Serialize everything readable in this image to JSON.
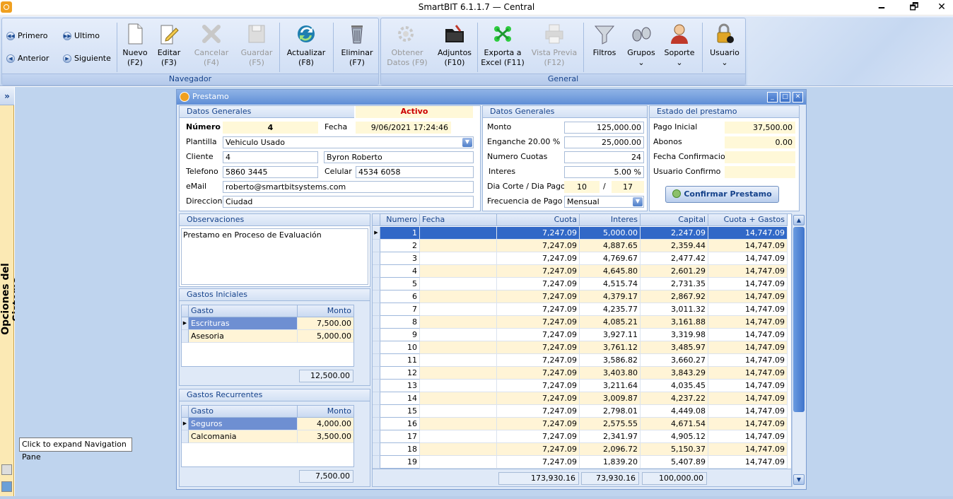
{
  "window": {
    "title": "SmartBIT 6.1.1.7 — Central",
    "minimize": "🗕",
    "maximize": "🗗",
    "close": "✕"
  },
  "ribbon": {
    "navegador": {
      "label": "Navegador",
      "primero": "Primero",
      "ultimo": "Ultimo",
      "anterior": "Anterior",
      "siguiente": "Siguiente",
      "nuevo": [
        "Nuevo",
        "(F2)"
      ],
      "editar": [
        "Editar",
        "(F3)"
      ],
      "cancelar": [
        "Cancelar",
        "(F4)"
      ],
      "guardar": [
        "Guardar",
        "(F5)"
      ],
      "actualizar": [
        "Actualizar",
        "(F8)"
      ],
      "eliminar": [
        "Eliminar",
        "(F7)"
      ]
    },
    "general": {
      "label": "General",
      "obtener": [
        "Obtener",
        "Datos (F9)"
      ],
      "adjuntos": [
        "Adjuntos",
        "(F10)"
      ],
      "exporta": [
        "Exporta a",
        "Excel (F11)"
      ],
      "vista": [
        "Vista Previa",
        "(F12)"
      ],
      "filtros": "Filtros",
      "grupos": "Grupos",
      "soporte": "Soporte",
      "usuario": "Usuario",
      "caret": "⌄"
    }
  },
  "navpane": {
    "toggle": "»",
    "title": "Opciones del Sistema"
  },
  "tooltip": "Click to expand Navigation Pane",
  "form": {
    "title": "Prestamo",
    "datos_generales": {
      "header": "Datos Generales",
      "estado": "Activo",
      "numero_label": "Número",
      "numero": "4",
      "fecha_label": "Fecha",
      "fecha": "9/06/2021 17:24:46",
      "plantilla_label": "Plantilla",
      "plantilla": "Vehiculo Usado",
      "cliente_label": "Cliente",
      "cliente_id": "4",
      "cliente_nombre": "Byron Roberto",
      "telefono_label": "Telefono",
      "telefono": "5860 3445",
      "celular_label": "Celular",
      "celular": "4534 6058",
      "email_label": "eMail",
      "email": "roberto@smartbitsystems.com",
      "direccion_label": "Direccion",
      "direccion": "Ciudad"
    },
    "datos_generales2": {
      "header": "Datos Generales",
      "monto_label": "Monto",
      "monto": "125,000.00",
      "enganche_label": "Enganche 20.00 %",
      "enganche": "25,000.00",
      "cuotas_label": "Numero Cuotas",
      "cuotas": "24",
      "interes_label": "Interes",
      "interes": "5.00 %",
      "dia_label": "Dia Corte / Dia Pago",
      "dia_corte": "10",
      "dia_sep": "/",
      "dia_pago": "17",
      "frecuencia_label": "Frecuencia de Pago",
      "frecuencia": "Mensual"
    },
    "estado_prestamo": {
      "header": "Estado del prestamo",
      "pago_inicial_label": "Pago Inicial",
      "pago_inicial": "37,500.00",
      "abonos_label": "Abonos",
      "abonos": "0.00",
      "fecha_conf_label": "Fecha Confirmacion",
      "fecha_conf": "",
      "usuario_conf_label": "Usuario Confirmo",
      "usuario_conf": "",
      "confirm_button": "Confirmar Prestamo"
    },
    "observaciones": {
      "header": "Observaciones",
      "text": "Prestamo en Proceso de Evaluación"
    },
    "gastos_iniciales": {
      "header": "Gastos Iniciales",
      "col_gasto": "Gasto",
      "col_monto": "Monto",
      "rows": [
        {
          "gasto": "Escrituras",
          "monto": "7,500.00"
        },
        {
          "gasto": "Asesoria",
          "monto": "5,000.00"
        }
      ],
      "total": "12,500.00"
    },
    "gastos_recurrentes": {
      "header": "Gastos Recurrentes",
      "col_gasto": "Gasto",
      "col_monto": "Monto",
      "rows": [
        {
          "gasto": "Seguros",
          "monto": "4,000.00"
        },
        {
          "gasto": "Calcomania",
          "monto": "3,500.00"
        }
      ],
      "total": "7,500.00"
    },
    "cuotas": {
      "columns": [
        "Numero",
        "Fecha",
        "Cuota",
        "Interes",
        "Capital",
        "Cuota + Gastos"
      ],
      "rows": [
        [
          "1",
          "",
          "7,247.09",
          "5,000.00",
          "2,247.09",
          "14,747.09"
        ],
        [
          "2",
          "",
          "7,247.09",
          "4,887.65",
          "2,359.44",
          "14,747.09"
        ],
        [
          "3",
          "",
          "7,247.09",
          "4,769.67",
          "2,477.42",
          "14,747.09"
        ],
        [
          "4",
          "",
          "7,247.09",
          "4,645.80",
          "2,601.29",
          "14,747.09"
        ],
        [
          "5",
          "",
          "7,247.09",
          "4,515.74",
          "2,731.35",
          "14,747.09"
        ],
        [
          "6",
          "",
          "7,247.09",
          "4,379.17",
          "2,867.92",
          "14,747.09"
        ],
        [
          "7",
          "",
          "7,247.09",
          "4,235.77",
          "3,011.32",
          "14,747.09"
        ],
        [
          "8",
          "",
          "7,247.09",
          "4,085.21",
          "3,161.88",
          "14,747.09"
        ],
        [
          "9",
          "",
          "7,247.09",
          "3,927.11",
          "3,319.98",
          "14,747.09"
        ],
        [
          "10",
          "",
          "7,247.09",
          "3,761.12",
          "3,485.97",
          "14,747.09"
        ],
        [
          "11",
          "",
          "7,247.09",
          "3,586.82",
          "3,660.27",
          "14,747.09"
        ],
        [
          "12",
          "",
          "7,247.09",
          "3,403.80",
          "3,843.29",
          "14,747.09"
        ],
        [
          "13",
          "",
          "7,247.09",
          "3,211.64",
          "4,035.45",
          "14,747.09"
        ],
        [
          "14",
          "",
          "7,247.09",
          "3,009.87",
          "4,237.22",
          "14,747.09"
        ],
        [
          "15",
          "",
          "7,247.09",
          "2,798.01",
          "4,449.08",
          "14,747.09"
        ],
        [
          "16",
          "",
          "7,247.09",
          "2,575.55",
          "4,671.54",
          "14,747.09"
        ],
        [
          "17",
          "",
          "7,247.09",
          "2,341.97",
          "4,905.12",
          "14,747.09"
        ],
        [
          "18",
          "",
          "7,247.09",
          "2,096.72",
          "5,150.37",
          "14,747.09"
        ],
        [
          "19",
          "",
          "7,247.09",
          "1,839.20",
          "5,407.89",
          "14,747.09"
        ]
      ],
      "totals": {
        "cuota": "173,930.16",
        "interes": "73,930.16",
        "capital": "100,000.00"
      }
    }
  },
  "colors": {
    "selected_row": "#3168c7",
    "alt_row": "#fff4d6",
    "accent": "#15428b",
    "estado_activo": "#cc0000"
  }
}
